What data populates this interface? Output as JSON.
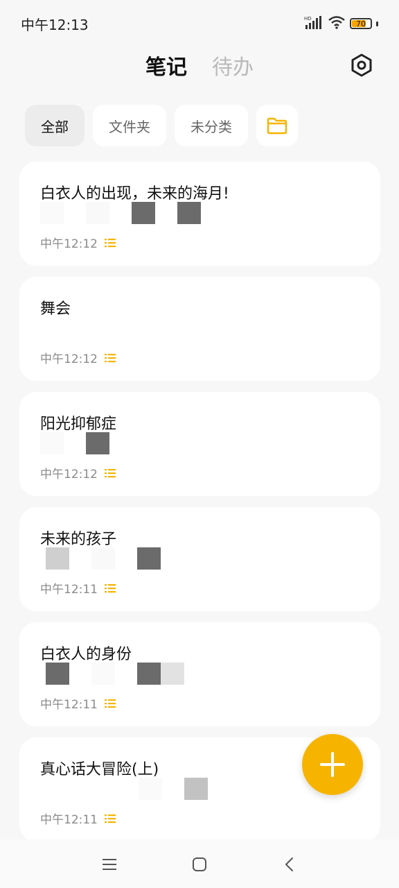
{
  "status": {
    "time": "中午12:13",
    "battery": "70",
    "hd": "HD"
  },
  "tabs": {
    "notes": "笔记",
    "todos": "待办"
  },
  "filters": {
    "all": "全部",
    "folders": "文件夹",
    "unsorted": "未分类"
  },
  "notes": [
    {
      "title": "白衣人的出现，未来的海月!",
      "time": "中午12:12"
    },
    {
      "title": "舞会",
      "time": "中午12:12"
    },
    {
      "title": "阳光抑郁症",
      "time": "中午12:12"
    },
    {
      "title": "未来的孩子",
      "time": "中午12:11"
    },
    {
      "title": "白衣人的身份",
      "time": "中午12:11"
    },
    {
      "title": "真心话大冒险(上)",
      "time": "中午12:11"
    }
  ],
  "colors": {
    "accent": "#f6b400",
    "background": "#f7f7f7",
    "card": "#ffffff"
  }
}
